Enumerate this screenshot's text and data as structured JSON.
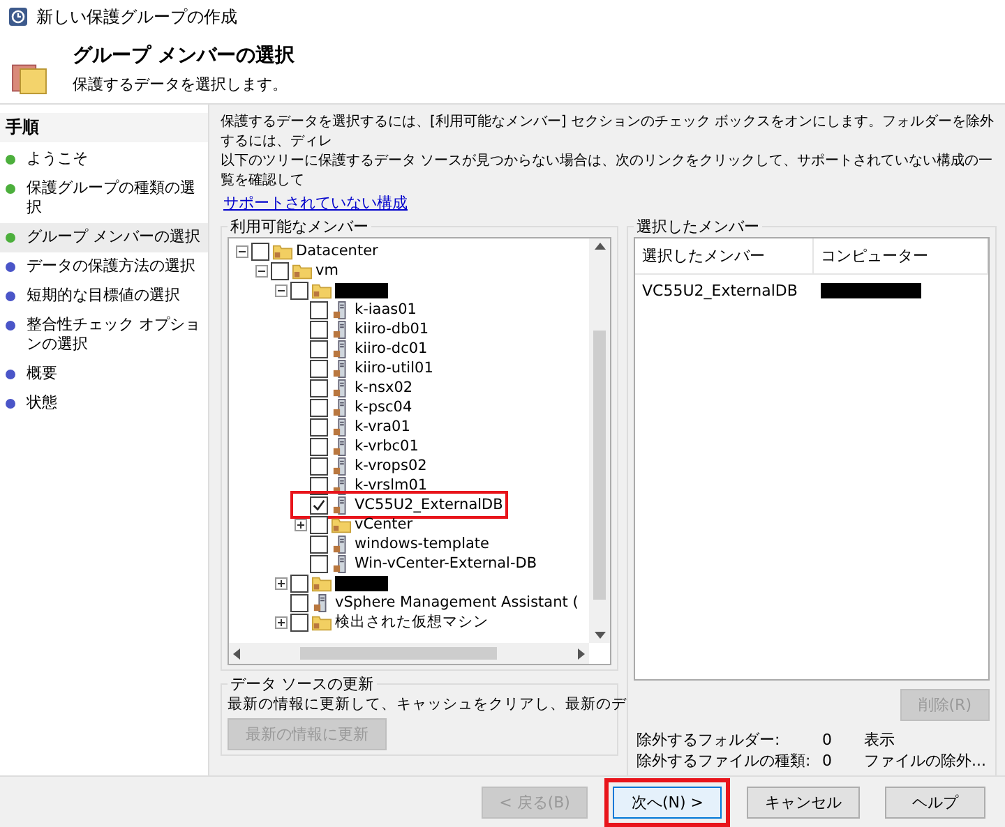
{
  "window": {
    "title": "新しい保護グループの作成"
  },
  "header": {
    "title": "グループ メンバーの選択",
    "subtitle": "保護するデータを選択します。"
  },
  "steps": {
    "title": "手順",
    "items": [
      {
        "label": "ようこそ",
        "color": "#4caf3c",
        "selected": false
      },
      {
        "label": "保護グループの種類の選択",
        "color": "#4caf3c",
        "selected": false
      },
      {
        "label": "グループ メンバーの選択",
        "color": "#4caf3c",
        "selected": true
      },
      {
        "label": "データの保護方法の選択",
        "color": "#4a55c8",
        "selected": false
      },
      {
        "label": "短期的な目標値の選択",
        "color": "#4a55c8",
        "selected": false
      },
      {
        "label": "整合性チェック オプションの選択",
        "color": "#4a55c8",
        "selected": false
      },
      {
        "label": "概要",
        "color": "#4a55c8",
        "selected": false
      },
      {
        "label": "状態",
        "color": "#4a55c8",
        "selected": false
      }
    ]
  },
  "intro": {
    "text": "保護するデータを選択するには、[利用可能なメンバー] セクションのチェック ボックスをオンにします。フォルダーを除外するには、ディレ",
    "text_2": "以下のツリーに保護するデータ ソースが見つからない場合は、次のリンクをクリックして、サポートされていない構成の一覧を確認して",
    "link": "サポートされていない構成"
  },
  "available": {
    "title": "利用可能なメンバー",
    "tree": [
      {
        "kind": "folder",
        "label": "Datacenter",
        "checked": false,
        "expanded": true,
        "children": [
          {
            "kind": "folder",
            "label": "vm",
            "checked": false,
            "expanded": true,
            "children": [
              {
                "kind": "folder",
                "redacted": true,
                "checked": false,
                "expanded": true,
                "children": [
                  {
                    "kind": "vm",
                    "label": "k-iaas01",
                    "checked": false
                  },
                  {
                    "kind": "vm",
                    "label": "kiiro-db01",
                    "checked": false
                  },
                  {
                    "kind": "vm",
                    "label": "kiiro-dc01",
                    "checked": false
                  },
                  {
                    "kind": "vm",
                    "label": "kiiro-util01",
                    "checked": false
                  },
                  {
                    "kind": "vm",
                    "label": "k-nsx02",
                    "checked": false
                  },
                  {
                    "kind": "vm",
                    "label": "k-psc04",
                    "checked": false
                  },
                  {
                    "kind": "vm",
                    "label": "k-vra01",
                    "checked": false
                  },
                  {
                    "kind": "vm",
                    "label": "k-vrbc01",
                    "checked": false
                  },
                  {
                    "kind": "vm",
                    "label": "k-vrops02",
                    "checked": false
                  },
                  {
                    "kind": "vm",
                    "label": "k-vrslm01",
                    "checked": false
                  },
                  {
                    "kind": "vm",
                    "label": "VC55U2_ExternalDB",
                    "checked": true,
                    "highlighted": true
                  },
                  {
                    "kind": "folder",
                    "label": "vCenter",
                    "checked": false,
                    "expanded": false
                  },
                  {
                    "kind": "vm",
                    "label": "windows-template",
                    "checked": false
                  },
                  {
                    "kind": "vm",
                    "label": "Win-vCenter-External-DB",
                    "checked": false
                  }
                ]
              },
              {
                "kind": "folder",
                "redacted": true,
                "checked": false,
                "expanded": false
              },
              {
                "kind": "vm",
                "label": "vSphere Management Assistant (",
                "checked": false
              },
              {
                "kind": "folder",
                "label": "検出された仮想マシン",
                "checked": false,
                "expanded": false
              }
            ]
          }
        ]
      }
    ]
  },
  "refresh": {
    "title": "データ ソースの更新",
    "text": "最新の情報に更新して、キャッシュをクリアし、最新のデ",
    "button": {
      "label": "最新の情報に更新",
      "disabled": true
    }
  },
  "selected_members": {
    "title": "選択したメンバー",
    "columns": [
      "選択したメンバー",
      "コンピューター"
    ],
    "rows": [
      {
        "member": "VC55U2_ExternalDB",
        "computer_redacted": true
      }
    ],
    "delete_button": {
      "label": "削除(R)",
      "disabled": true
    },
    "exclusions": [
      {
        "label": "除外するフォルダー:",
        "count": "0",
        "action": "表示"
      },
      {
        "label": "除外するファイルの種類:",
        "count": "0",
        "action": "ファイルの除外..."
      }
    ]
  },
  "buttons": [
    {
      "label": "< 戻る(B)",
      "disabled": true,
      "highlighted": false
    },
    {
      "label": "次へ(N) >",
      "disabled": false,
      "highlighted": true
    },
    {
      "label": "キャンセル",
      "disabled": false,
      "highlighted": false
    },
    {
      "label": "ヘルプ",
      "disabled": false,
      "highlighted": false
    }
  ]
}
